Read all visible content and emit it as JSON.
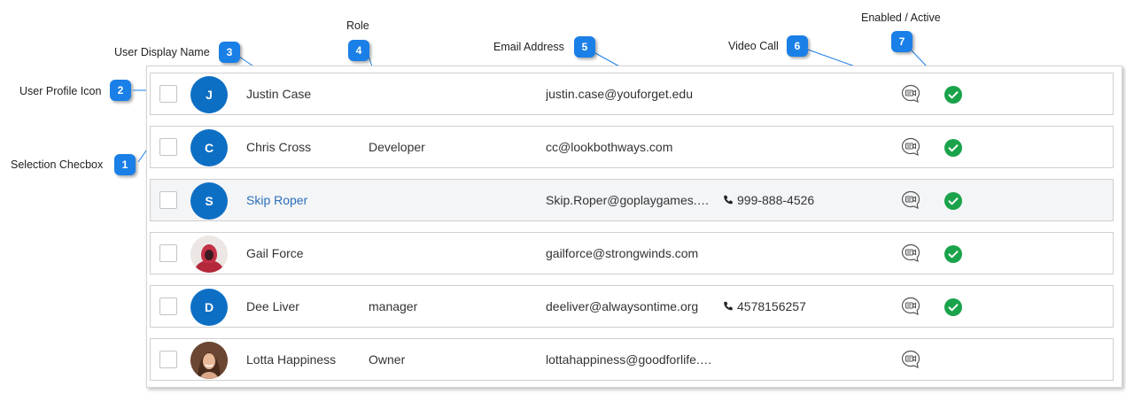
{
  "callouts": [
    {
      "number": "1",
      "label": "Selection Checbox"
    },
    {
      "number": "2",
      "label": "User Profile Icon"
    },
    {
      "number": "3",
      "label": "User Display Name"
    },
    {
      "number": "4",
      "label": "Role"
    },
    {
      "number": "5",
      "label": "Email Address"
    },
    {
      "number": "6",
      "label": "Video Call"
    },
    {
      "number": "7",
      "label": "Enabled / Active"
    }
  ],
  "users": [
    {
      "initial": "J",
      "avatar_type": "initial",
      "name": "Justin Case",
      "role": "",
      "email": "justin.case@youforget.edu",
      "phone": "",
      "video_icon": "video-chat-icon",
      "active": true
    },
    {
      "initial": "C",
      "avatar_type": "initial",
      "name": "Chris Cross",
      "role": "Developer",
      "email": "cc@lookbothways.com",
      "phone": "",
      "video_icon": "video-chat-icon",
      "active": true
    },
    {
      "initial": "S",
      "avatar_type": "initial",
      "name": "Skip Roper",
      "role": "",
      "email": "Skip.Roper@goplaygames.com",
      "phone": "999-888-4526",
      "video_icon": "video-chat-icon",
      "active": true,
      "hovered": true
    },
    {
      "initial": "",
      "avatar_type": "photo",
      "name": "Gail Force",
      "role": "",
      "email": "gailforce@strongwinds.com",
      "phone": "",
      "video_icon": "video-chat-icon",
      "active": true
    },
    {
      "initial": "D",
      "avatar_type": "initial",
      "name": "Dee Liver",
      "role": "manager",
      "email": "deeliver@alwaysontime.org",
      "phone": "4578156257",
      "video_icon": "video-chat-icon",
      "active": true
    },
    {
      "initial": "",
      "avatar_type": "photo",
      "name": "Lotta Happiness",
      "role": "Owner",
      "email": "lottahappiness@goodforlife.com",
      "phone": "",
      "video_icon": "video-chat-icon",
      "active": false
    }
  ],
  "colors": {
    "callout_badge": "#1a7fe6",
    "avatar": "#0d6fc4",
    "link_name": "#2a6ebb",
    "active_check": "#1aa34a",
    "row_hover": "#f4f5f7"
  }
}
